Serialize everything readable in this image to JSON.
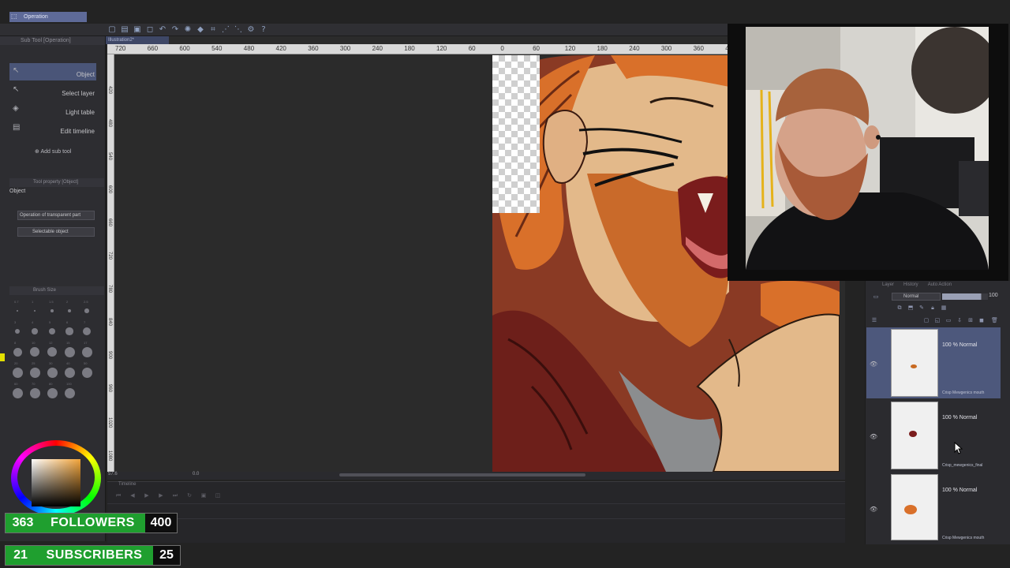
{
  "toolbar": {
    "icons": [
      "new-canvas-icon",
      "open-file-icon",
      "save-icon",
      "undo-icon",
      "redo-icon",
      "transform-icon",
      "settings-icon",
      "help-icon"
    ]
  },
  "canvas": {
    "tab_label": "Illustration2*",
    "ruler_h_ticks": [
      "720",
      "660",
      "600",
      "540",
      "480",
      "420",
      "360",
      "300",
      "240",
      "180",
      "120",
      "60",
      "0",
      "60",
      "120",
      "180",
      "240",
      "300",
      "360",
      "420"
    ],
    "ruler_v_ticks": [
      "420",
      "480",
      "540",
      "600",
      "660",
      "720",
      "780",
      "840",
      "900",
      "960",
      "1020",
      "1080"
    ],
    "zoom": "57.6",
    "angle": "0.0"
  },
  "left_panel": {
    "sub_tool_header": "Sub Tool [Operation]",
    "operation_label": "Operation",
    "sub_tools": [
      {
        "label": "Object",
        "icon": "object-select-icon"
      },
      {
        "label": "Select layer",
        "icon": "select-layer-icon"
      },
      {
        "label": "Light table",
        "icon": "light-table-icon"
      },
      {
        "label": "Edit timeline",
        "icon": "edit-timeline-icon"
      }
    ],
    "add_sub_tool": "Add sub tool",
    "tool_property_header": "Tool property [Object]",
    "tool_property_label": "Object",
    "transparent_part_option": "Operation of transparent part",
    "selectable_object_option": "Selectable object",
    "brush_size_header": "Brush Size",
    "brush_sizes": [
      "0.7",
      "1",
      "1.5",
      "2",
      "2.5",
      "3",
      "4",
      "5",
      "6",
      "7",
      "8",
      "10",
      "12",
      "15",
      "17",
      "20",
      "25",
      "30",
      "40",
      "50",
      "60",
      "70",
      "80",
      "100"
    ]
  },
  "timeline": {
    "header": "Timeline"
  },
  "layers": {
    "tabs": [
      "Layer",
      "History",
      "Auto Action"
    ],
    "blend_mode": "Normal",
    "opacity": "100",
    "opacity_fraction": 0.85,
    "items": [
      {
        "mode": "100 % Normal",
        "name": "Crisp Mewgenics mouth",
        "selected": true
      },
      {
        "mode": "100 % Normal",
        "name": "Crisp_mewgenics_final",
        "selected": false
      },
      {
        "mode": "100 % Normal",
        "name": "Crisp Mewgenics mouth",
        "selected": false
      }
    ]
  },
  "overlay": {
    "followers_current": "363",
    "followers_label": "FOLLOWERS",
    "followers_goal": "400",
    "subscribers_current": "21",
    "subscribers_label": "SUBSCRIBERS",
    "subscribers_goal": "25"
  },
  "colors": {
    "accent": "#5e6a98",
    "overlay_green": "#1f9f2f"
  }
}
